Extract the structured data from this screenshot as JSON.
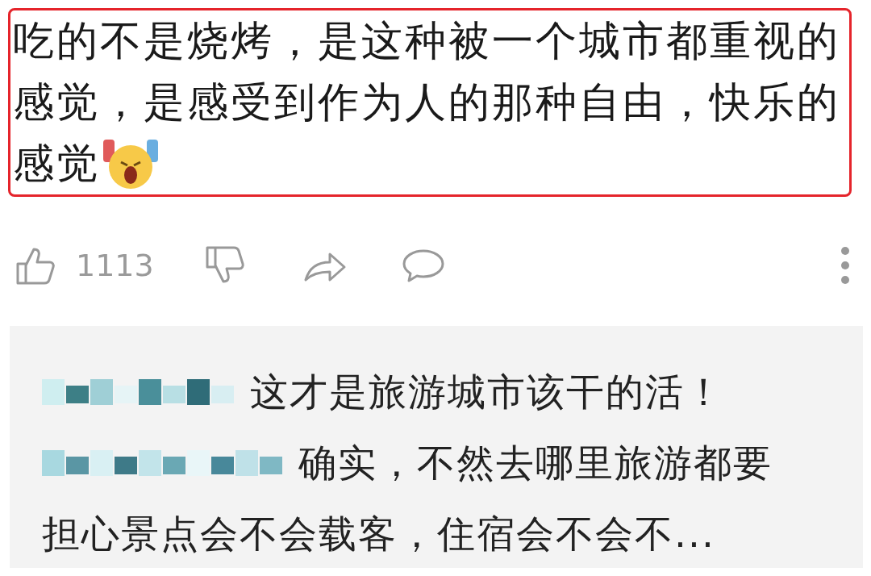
{
  "comment": {
    "lines": [
      "吃的不是烧烤，是这种被一个城市都重视的",
      "感觉，是感受到作为人的那种自由，快乐的",
      "感觉"
    ],
    "highlighted": true
  },
  "actions": {
    "like_count": "1113"
  },
  "replies": [
    {
      "lines": [
        "这才是旅游城市该干的活！"
      ]
    },
    {
      "lines": [
        "确实，不然去哪里旅游都要",
        "担心景点会不会载客，住宿会不会不..."
      ]
    }
  ]
}
